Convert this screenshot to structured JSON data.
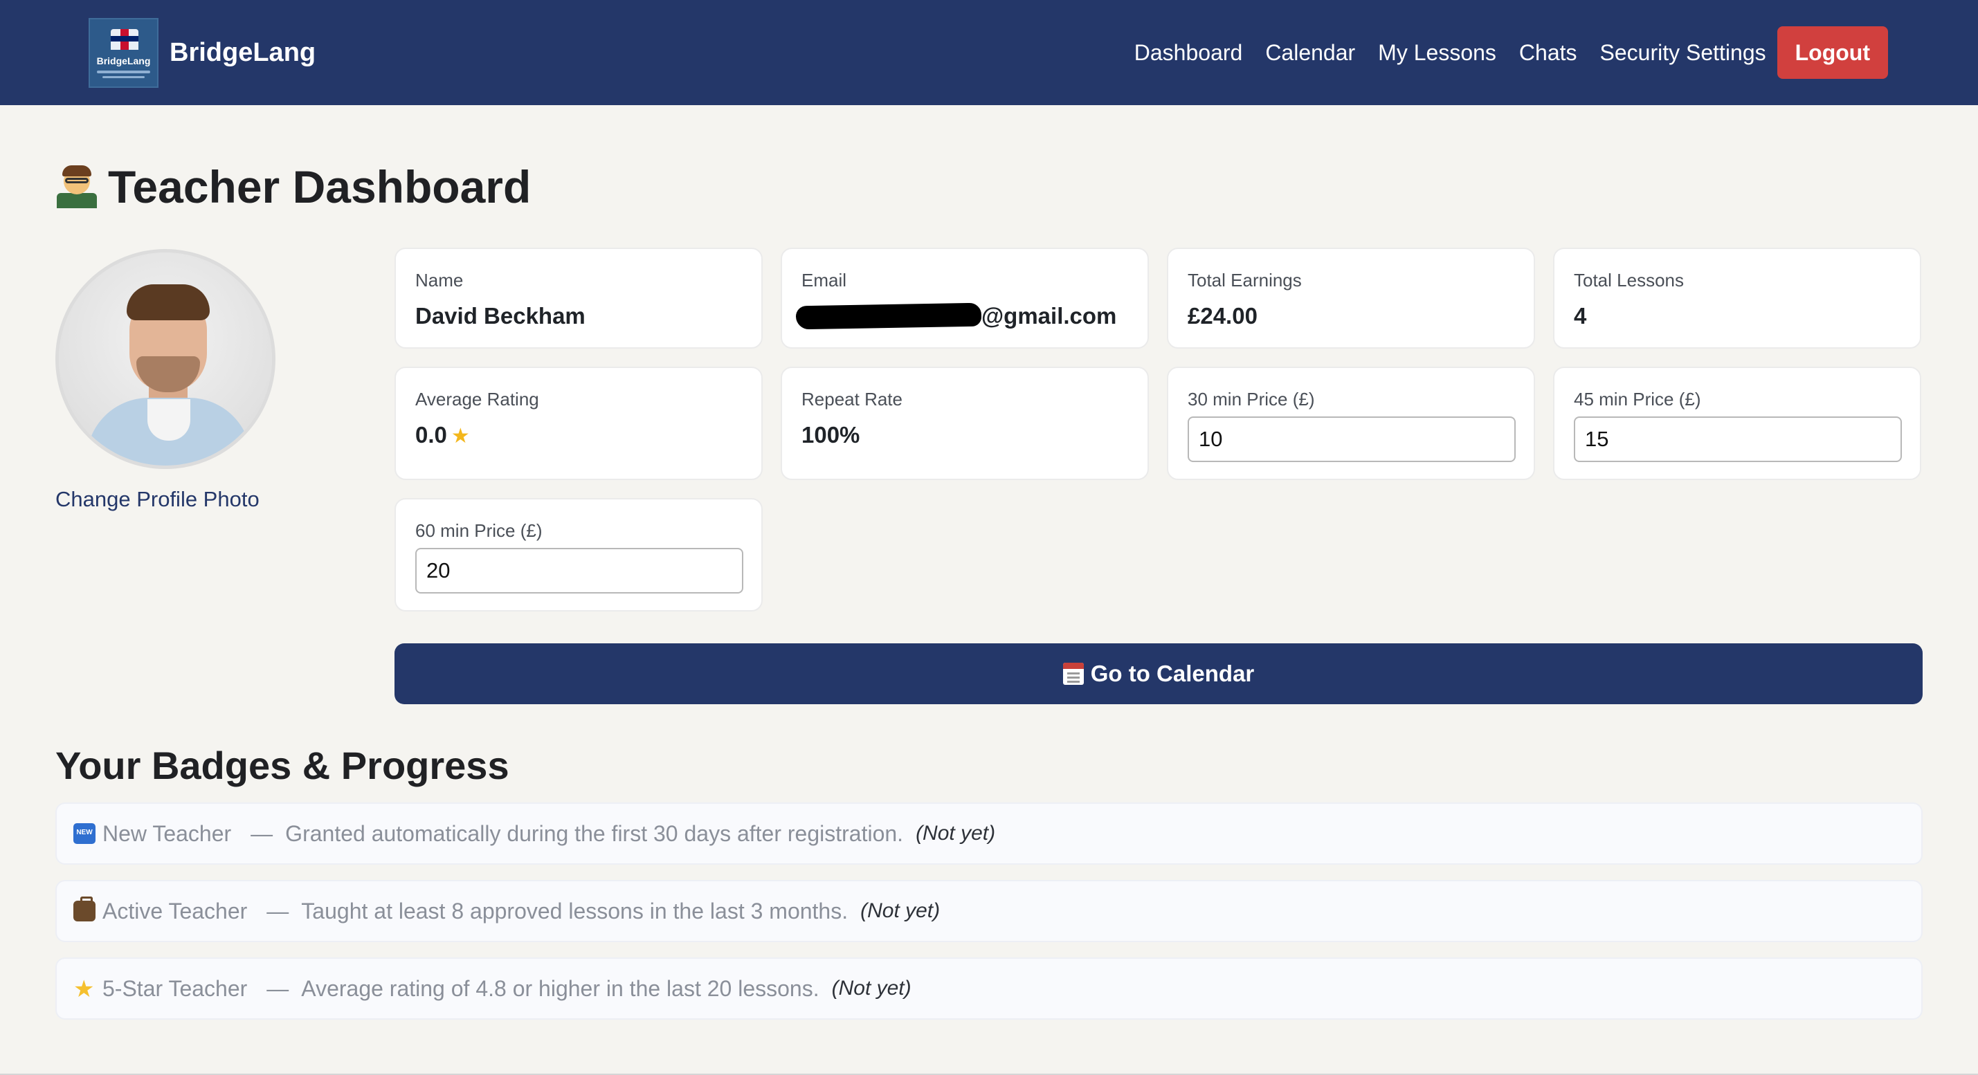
{
  "nav": {
    "brand": "BridgeLang",
    "logo_text": "BridgeLang",
    "links": [
      "Dashboard",
      "Calendar",
      "My Lessons",
      "Chats",
      "Security Settings"
    ],
    "logout": "Logout"
  },
  "page": {
    "title": "Teacher Dashboard",
    "change_photo": "Change Profile Photo"
  },
  "stats": {
    "name_label": "Name",
    "name_value": "David Beckham",
    "email_label": "Email",
    "email_visible": "@gmail.com",
    "earnings_label": "Total Earnings",
    "earnings_value": "£24.00",
    "lessons_label": "Total Lessons",
    "lessons_value": "4",
    "rating_label": "Average Rating",
    "rating_value": "0.0",
    "repeat_label": "Repeat Rate",
    "repeat_value": "100%",
    "price30_label": "30 min Price (£)",
    "price30_value": "10",
    "price45_label": "45 min Price (£)",
    "price45_value": "15",
    "price60_label": "60 min Price (£)",
    "price60_value": "20"
  },
  "calendar_button": "Go to Calendar",
  "badges": {
    "title": "Your Badges & Progress",
    "items": [
      {
        "icon": "new-icon",
        "name": "New Teacher",
        "dash": "—",
        "description": "Granted automatically during the first 30 days after registration.",
        "status": "(Not yet)"
      },
      {
        "icon": "briefcase-icon",
        "name": "Active Teacher",
        "dash": "—",
        "description": "Taught at least 8 approved lessons in the last 3 months.",
        "status": "(Not yet)"
      },
      {
        "icon": "star-icon",
        "name": "5-Star Teacher",
        "dash": "—",
        "description": "Average rating of 4.8 or higher in the last 20 lessons.",
        "status": "(Not yet)"
      }
    ]
  },
  "colors": {
    "navbar": "#243769",
    "logout": "#d1403e",
    "background": "#f5f4f0"
  }
}
